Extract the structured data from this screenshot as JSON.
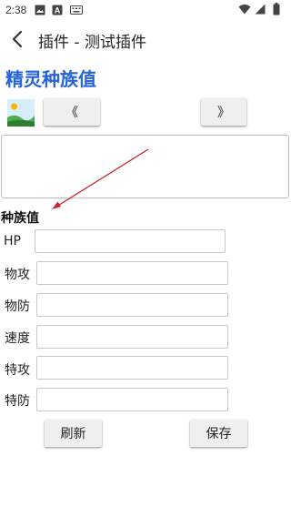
{
  "status_bar": {
    "time": "2:38",
    "left_icons": [
      "image-icon",
      "a-box-icon",
      "keyboard-icon"
    ],
    "right_icons": [
      "wifi-icon",
      "signal-icon",
      "battery-icon"
    ]
  },
  "app_bar": {
    "back_icon": "back-arrow-icon",
    "title": "插件 - 测试插件"
  },
  "page_title": "精灵种族值",
  "image_icon": "picture-icon",
  "nav": {
    "prev_label": "《",
    "next_label": "》"
  },
  "section_title": "种族值",
  "fields": [
    {
      "label": "HP",
      "value": ""
    },
    {
      "label": "物攻",
      "value": ""
    },
    {
      "label": "物防",
      "value": ""
    },
    {
      "label": "速度",
      "value": ""
    },
    {
      "label": "特攻",
      "value": ""
    },
    {
      "label": "特防",
      "value": ""
    }
  ],
  "actions": {
    "refresh_label": "刷新",
    "save_label": "保存"
  },
  "colors": {
    "title_blue": "#2563d9",
    "arrow_red": "#d0202a"
  }
}
